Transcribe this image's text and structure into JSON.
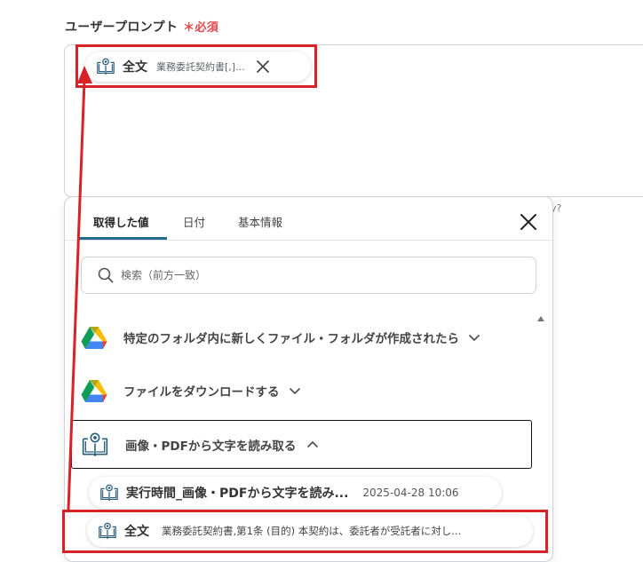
{
  "field": {
    "label": "ユーザープロンプト",
    "required_mark": "＊必須"
  },
  "prompt_chip": {
    "label": "全文",
    "value": "業務委託契約書[,]...",
    "icon": "book-ocr-icon"
  },
  "hint_fragment": "y?",
  "panel": {
    "tabs": [
      {
        "label": "取得した値",
        "active": true
      },
      {
        "label": "日付",
        "active": false
      },
      {
        "label": "基本情報",
        "active": false
      }
    ],
    "search_placeholder": "検索（前方一致）",
    "sections": [
      {
        "label": "特定のフォルダ内に新しくファイル・フォルダが作成されたら",
        "icon": "google-drive-icon",
        "expanded": false
      },
      {
        "label": "ファイルをダウンロードする",
        "icon": "google-drive-icon",
        "expanded": false
      },
      {
        "label": "画像・PDFから文字を読み取る",
        "icon": "book-ocr-icon",
        "expanded": true
      }
    ],
    "items": [
      {
        "label": "実行時間_画像・PDFから文字を読み...",
        "value": "2025-04-28 10:06"
      },
      {
        "label": "全文",
        "value": "業務委託契約書,第1条 (目的) 本契約は、委託者が受託者に対し..."
      }
    ]
  },
  "colors": {
    "highlight": "#d62228",
    "required": "#e0474c",
    "tab_underline": "#1c6c8a"
  }
}
